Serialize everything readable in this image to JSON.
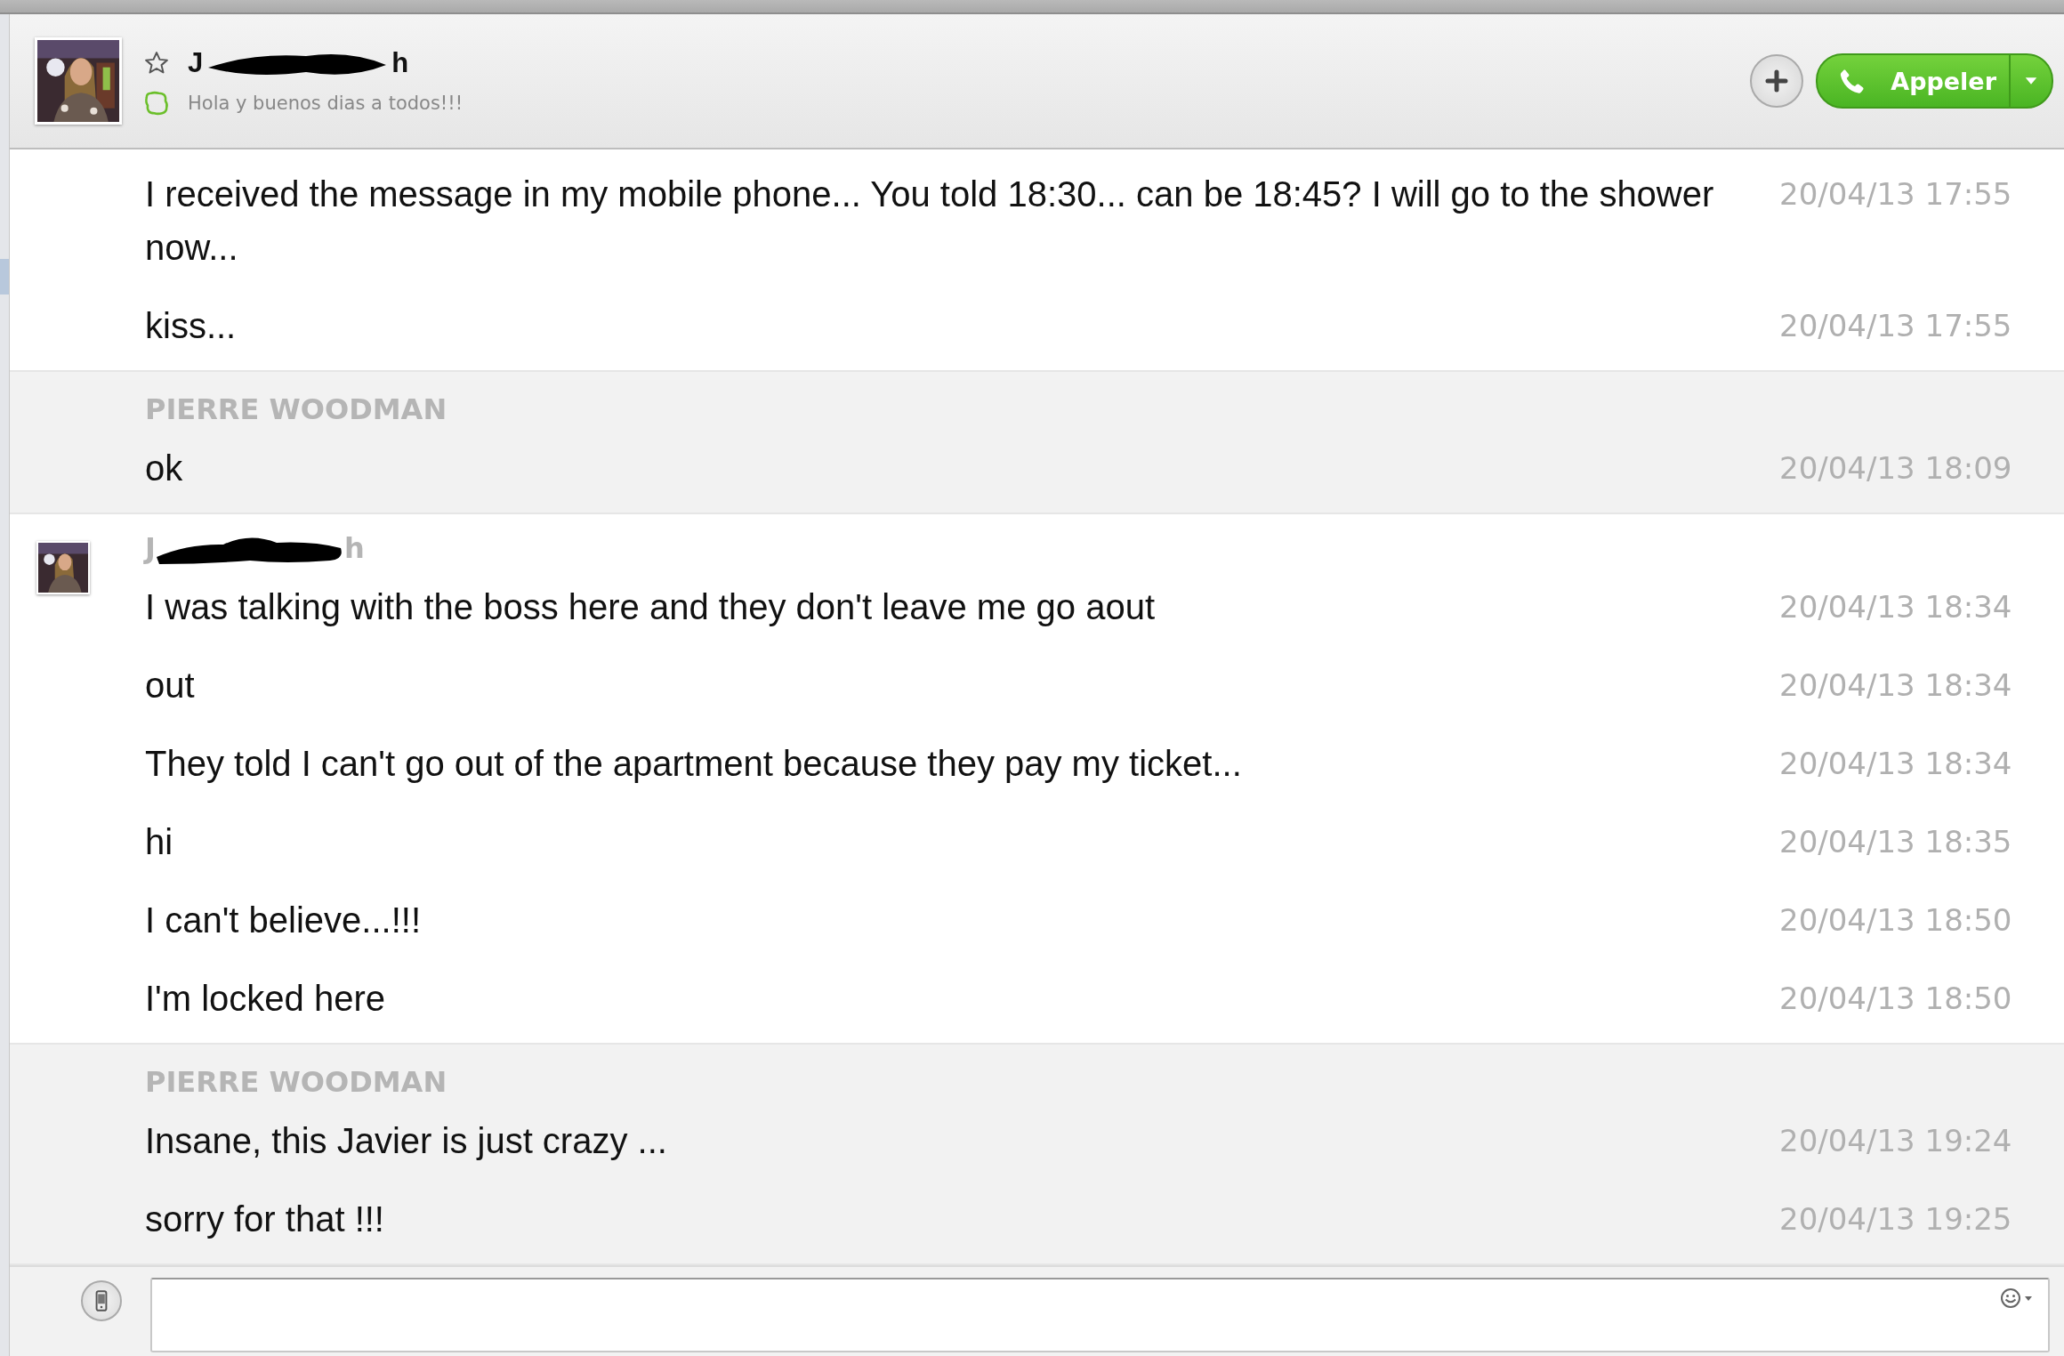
{
  "header": {
    "favorite": false,
    "name": {
      "visible_start": "J",
      "visible_end": "h",
      "redacted": true
    },
    "mood": "Hola y buenos dias a todos!!!",
    "call_button": "Appeler"
  },
  "conversation": [
    {
      "shaded": false,
      "avatar": false,
      "messages": [
        {
          "text": "I received the message in my mobile phone... You told 18:30... can be 18:45? I will go to the shower now...",
          "time": "20/04/13 17:55"
        },
        {
          "text": "kiss...",
          "time": "20/04/13 17:55"
        }
      ]
    },
    {
      "shaded": true,
      "avatar": false,
      "sender": {
        "name": "PIERRE WOODMAN",
        "redacted": false
      },
      "messages": [
        {
          "text": "ok",
          "time": "20/04/13 18:09"
        }
      ]
    },
    {
      "shaded": false,
      "avatar": true,
      "sender": {
        "visible_start": "J",
        "visible_end": "h",
        "redacted": true
      },
      "messages": [
        {
          "text": "I was talking with the boss here and they don't leave me go aout",
          "time": "20/04/13 18:34"
        },
        {
          "text": "out",
          "time": "20/04/13 18:34"
        },
        {
          "text": "They told I can't go out of the apartment because they pay my ticket...",
          "time": "20/04/13 18:34"
        },
        {
          "text": "hi",
          "time": "20/04/13 18:35"
        },
        {
          "text": "I can't believe...!!!",
          "time": "20/04/13 18:50"
        },
        {
          "text": "I'm locked here",
          "time": "20/04/13 18:50"
        }
      ]
    },
    {
      "shaded": true,
      "avatar": false,
      "sender": {
        "name": "PIERRE WOODMAN",
        "redacted": false
      },
      "messages": [
        {
          "text": "Insane, this Javier is just crazy ...",
          "time": "20/04/13 19:24"
        },
        {
          "text": "sorry for that !!!",
          "time": "20/04/13 19:25"
        }
      ]
    }
  ]
}
